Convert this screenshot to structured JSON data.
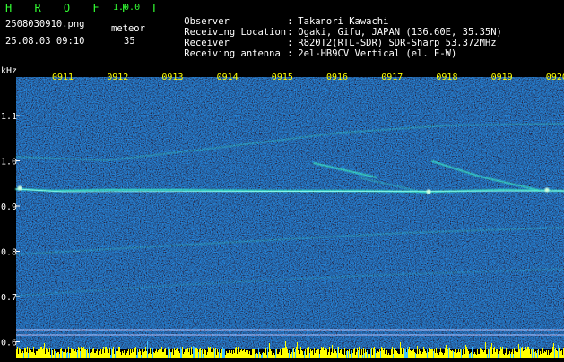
{
  "app": {
    "brand": "H R O F F T",
    "version": "1.0.0"
  },
  "file": {
    "name": "2508030910.png",
    "datetime": "25.08.03 09:10"
  },
  "meteor": {
    "label": "meteor",
    "count": "35"
  },
  "info": [
    {
      "label": "Observer",
      "value": "Takanori Kawachi"
    },
    {
      "label": "Receiving Location",
      "value": "Ogaki, Gifu, JAPAN (136.60E, 35.35N)"
    },
    {
      "label": "Receiver",
      "value": "R820T2(RTL-SDR) SDR-Sharp 53.372MHz"
    },
    {
      "label": "Receiving antenna",
      "value": "2el-HB9CV Vertical (el. E-W)"
    }
  ],
  "colors": {
    "background": "#000000",
    "spectrogram_base": "#0a1450",
    "text": "#ffffff",
    "tick_labels": "#ffff00",
    "brand": "#33ff33",
    "signal": "#40ffcc",
    "level_bar": "#ffff00",
    "level_bar_edge": "#40c0ff"
  },
  "spectrogram": {
    "y_unit": "kHz",
    "y_ticks": [
      "1.1",
      "1.0",
      "0.9",
      "0.8",
      "0.7",
      "0.6"
    ],
    "x_ticks": [
      "0911",
      "0912",
      "0913",
      "0914",
      "0915",
      "0916",
      "0917",
      "0918",
      "0919",
      "0920"
    ]
  }
}
